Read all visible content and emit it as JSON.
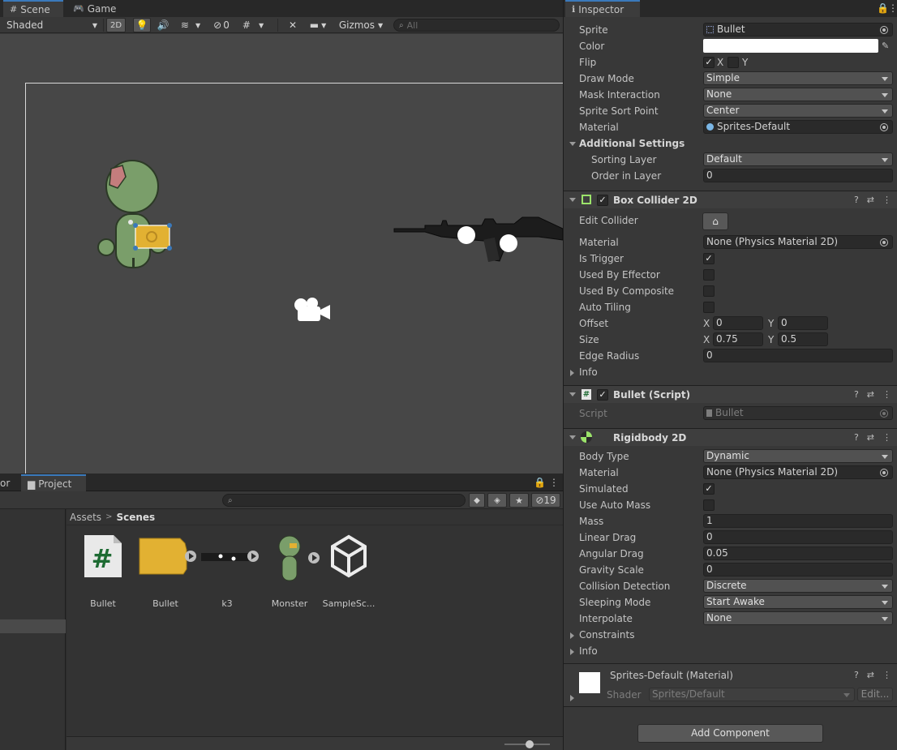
{
  "scene": {
    "tabs": [
      {
        "label": "Scene"
      },
      {
        "label": "Game"
      }
    ],
    "toolbar": {
      "shading_mode": "Shaded",
      "mode_2d": "2D",
      "hidden_count": "0",
      "gizmos": "Gizmos",
      "search_placeholder": "All"
    }
  },
  "project": {
    "tabs": [
      {
        "label": "or"
      },
      {
        "label": "Project"
      }
    ],
    "hidden_count": "19",
    "breadcrumb": {
      "root": "Assets",
      "separator": ">",
      "current": "Scenes"
    },
    "assets": [
      {
        "label": "Bullet",
        "icon": "csharp-script-icon"
      },
      {
        "label": "Bullet",
        "icon": "bullet-sprite-icon"
      },
      {
        "label": "k3",
        "icon": "rifle-sprite-icon"
      },
      {
        "label": "Monster",
        "icon": "monster-sprite-icon"
      },
      {
        "label": "SampleSc...",
        "icon": "unity-scene-icon"
      }
    ]
  },
  "inspector": {
    "tab": "Inspector",
    "sprite_renderer": {
      "sprite_label": "Sprite",
      "sprite_value": "Bullet",
      "color_label": "Color",
      "color_value": "#ffffff",
      "flip_label": "Flip",
      "flip_x": "X",
      "flip_y": "Y",
      "draw_mode_label": "Draw Mode",
      "draw_mode_value": "Simple",
      "mask_label": "Mask Interaction",
      "mask_value": "None",
      "sort_point_label": "Sprite Sort Point",
      "sort_point_value": "Center",
      "material_label": "Material",
      "material_value": "Sprites-Default",
      "additional_label": "Additional Settings",
      "sorting_layer_label": "Sorting Layer",
      "sorting_layer_value": "Default",
      "order_label": "Order in Layer",
      "order_value": "0"
    },
    "box_collider": {
      "title": "Box Collider 2D",
      "edit_label": "Edit Collider",
      "material_label": "Material",
      "material_value": "None (Physics Material 2D)",
      "trigger_label": "Is Trigger",
      "effector_label": "Used By Effector",
      "composite_label": "Used By Composite",
      "tiling_label": "Auto Tiling",
      "offset_label": "Offset",
      "offset_x": "0",
      "offset_y": "0",
      "size_label": "Size",
      "size_x": "0.75",
      "size_y": "0.5",
      "x_label": "X",
      "y_label": "Y",
      "edge_label": "Edge Radius",
      "edge_value": "0",
      "info_label": "Info"
    },
    "bullet_script": {
      "title": "Bullet (Script)",
      "script_label": "Script",
      "script_value": "Bullet"
    },
    "rigidbody": {
      "title": "Rigidbody 2D",
      "body_type_label": "Body Type",
      "body_type_value": "Dynamic",
      "material_label": "Material",
      "material_value": "None (Physics Material 2D)",
      "simulated_label": "Simulated",
      "auto_mass_label": "Use Auto Mass",
      "mass_label": "Mass",
      "mass_value": "1",
      "linear_drag_label": "Linear Drag",
      "linear_drag_value": "0",
      "angular_drag_label": "Angular Drag",
      "angular_drag_value": "0.05",
      "gravity_label": "Gravity Scale",
      "gravity_value": "0",
      "collision_label": "Collision Detection",
      "collision_value": "Discrete",
      "sleeping_label": "Sleeping Mode",
      "sleeping_value": "Start Awake",
      "interpolate_label": "Interpolate",
      "interpolate_value": "None",
      "constraints_label": "Constraints",
      "info_label": "Info"
    },
    "material": {
      "title": "Sprites-Default (Material)",
      "shader_label": "Shader",
      "shader_value": "Sprites/Default",
      "edit_label": "Edit..."
    },
    "add_component": "Add Component"
  },
  "colors": {
    "accent": "#3a79bb",
    "panel": "#383838",
    "viewport": "#474747"
  }
}
